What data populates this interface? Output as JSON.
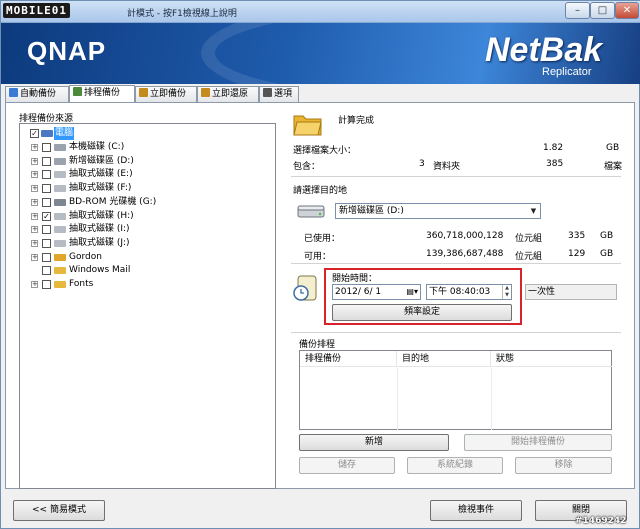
{
  "window": {
    "watermark_logo": "MOBILE01",
    "title": "計模式 - 按F1檢視線上說明",
    "min_glyph": "–",
    "max_glyph": "□",
    "close_glyph": "✕"
  },
  "banner": {
    "brand": "QNAP",
    "product": "NetBak",
    "subtitle": "Replicator"
  },
  "tabs": [
    {
      "label": "自動備份",
      "icon_color": "#3a7bd5"
    },
    {
      "label": "排程備份",
      "icon_color": "#4a8a3a",
      "active": true
    },
    {
      "label": "立即備份",
      "icon_color": "#c48a1e"
    },
    {
      "label": "立即還原",
      "icon_color": "#c48a1e"
    },
    {
      "label": "選項",
      "icon_color": "#555555"
    }
  ],
  "source": {
    "label": "排程備份來源",
    "root": {
      "label": "電腦",
      "checked": true
    },
    "items": [
      {
        "label": "本機磁碟 (C:)",
        "checked": false,
        "icon": "hard-drive-icon"
      },
      {
        "label": "新增磁碟區 (D:)",
        "checked": false,
        "icon": "hard-drive-icon"
      },
      {
        "label": "抽取式磁碟 (E:)",
        "checked": false,
        "icon": "removable-drive-icon"
      },
      {
        "label": "抽取式磁碟 (F:)",
        "checked": false,
        "icon": "removable-drive-icon"
      },
      {
        "label": "BD-ROM 光碟機 (G:)",
        "checked": false,
        "icon": "optical-drive-icon"
      },
      {
        "label": "抽取式磁碟 (H:)",
        "checked": true,
        "icon": "removable-drive-icon"
      },
      {
        "label": "抽取式磁碟 (I:)",
        "checked": false,
        "icon": "removable-drive-icon"
      },
      {
        "label": "抽取式磁碟 (J:)",
        "checked": false,
        "icon": "removable-drive-icon"
      },
      {
        "label": "Gordon",
        "checked": false,
        "icon": "user-folder-icon"
      },
      {
        "label": "Windows Mail",
        "checked": false,
        "icon": "folder-icon",
        "no_expander": true
      },
      {
        "label": "Fonts",
        "checked": false,
        "icon": "folder-icon"
      }
    ]
  },
  "summary": {
    "status": "計算完成",
    "size_label": "選擇檔案大小：",
    "size_value": "1.82",
    "size_unit": "GB",
    "contains_label": "包含：",
    "folders_count": "3",
    "folders_unit": "資料夾",
    "files_count": "385",
    "files_unit": "檔案"
  },
  "destination": {
    "label": "請選擇目的地",
    "selected": "新增磁碟區 (D:)",
    "used_label": "已使用：",
    "used_bytes": "360,718,000,128",
    "used_bytes_unit": "位元組",
    "used_gb": "335",
    "used_gb_unit": "GB",
    "free_label": "可用：",
    "free_bytes": "139,386,687,488",
    "free_bytes_unit": "位元組",
    "free_gb": "129",
    "free_gb_unit": "GB"
  },
  "schedule": {
    "start_label": "開始時間：",
    "date": "2012/ 6/ 1",
    "time": "下午 08:40:03",
    "frequency": "一次性",
    "frequency_button": "頻率設定"
  },
  "jobs": {
    "label": "備份排程",
    "columns": [
      "排程備份",
      "目的地",
      "狀態"
    ],
    "rows": []
  },
  "actions": {
    "add": "新增",
    "start": "開始排程備份",
    "save": "儲存",
    "log": "系統紀錄",
    "remove": "移除"
  },
  "footer": {
    "simple_mode": "<< 簡易模式",
    "view_events": "檢視事件",
    "close": "關閉",
    "watermark": "#1469242"
  }
}
